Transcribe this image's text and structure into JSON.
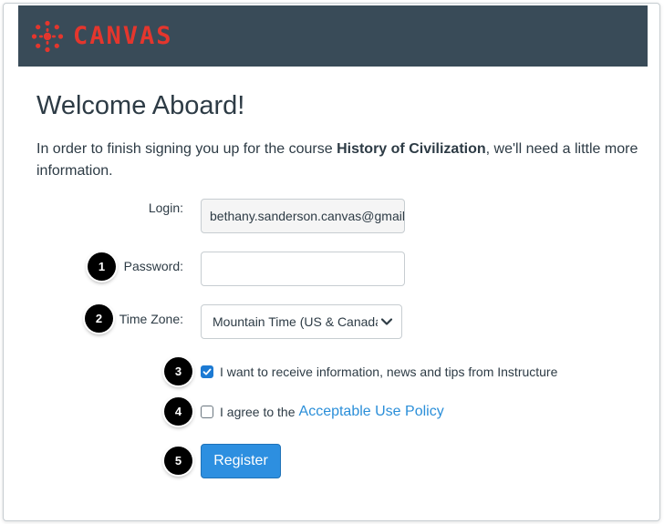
{
  "header": {
    "brand_name": "CANVAS",
    "logo_icon": "canvas-logo-icon",
    "colors": {
      "bar": "#394b58",
      "brand": "#e4362d"
    }
  },
  "page": {
    "title": "Welcome Aboard!",
    "intro_before": "In order to finish signing you up for the course ",
    "course_name": "History of Civilization",
    "intro_after": ", we'll need a little more information."
  },
  "form": {
    "login_label": "Login:",
    "login_value": "bethany.sanderson.canvas@gmail.",
    "password_label": "Password:",
    "password_value": "",
    "timezone_label": "Time Zone:",
    "timezone_value": "Mountain Time (US & Canada",
    "newsletter_label": "I want to receive information, news and tips from Instructure",
    "newsletter_checked": true,
    "aup_label": "I agree to the",
    "aup_link": "Acceptable Use Policy",
    "aup_checked": false,
    "register_label": "Register"
  },
  "steps": [
    "1",
    "2",
    "3",
    "4",
    "5"
  ],
  "colors": {
    "link": "#2b8fd9",
    "button": "#2d8fe0",
    "checkbox": "#1c7ad3"
  }
}
